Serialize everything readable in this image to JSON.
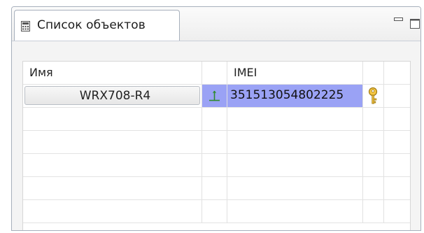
{
  "panel": {
    "tab_title": "Список объектов",
    "tab_icon": "calculator-icon",
    "minimize_icon": "minimize-icon",
    "maximize_icon": "maximize-icon"
  },
  "table": {
    "columns": [
      "Имя",
      "",
      "IMEI",
      "",
      ""
    ],
    "rows": [
      {
        "name": "WRX708-R4",
        "status_icon": "antenna-icon",
        "imei": "351513054802225",
        "key_icon": "key-icon",
        "status_color": "#9aa2f5",
        "key_color": "#e3b52a"
      }
    ],
    "empty_rows": 5
  }
}
